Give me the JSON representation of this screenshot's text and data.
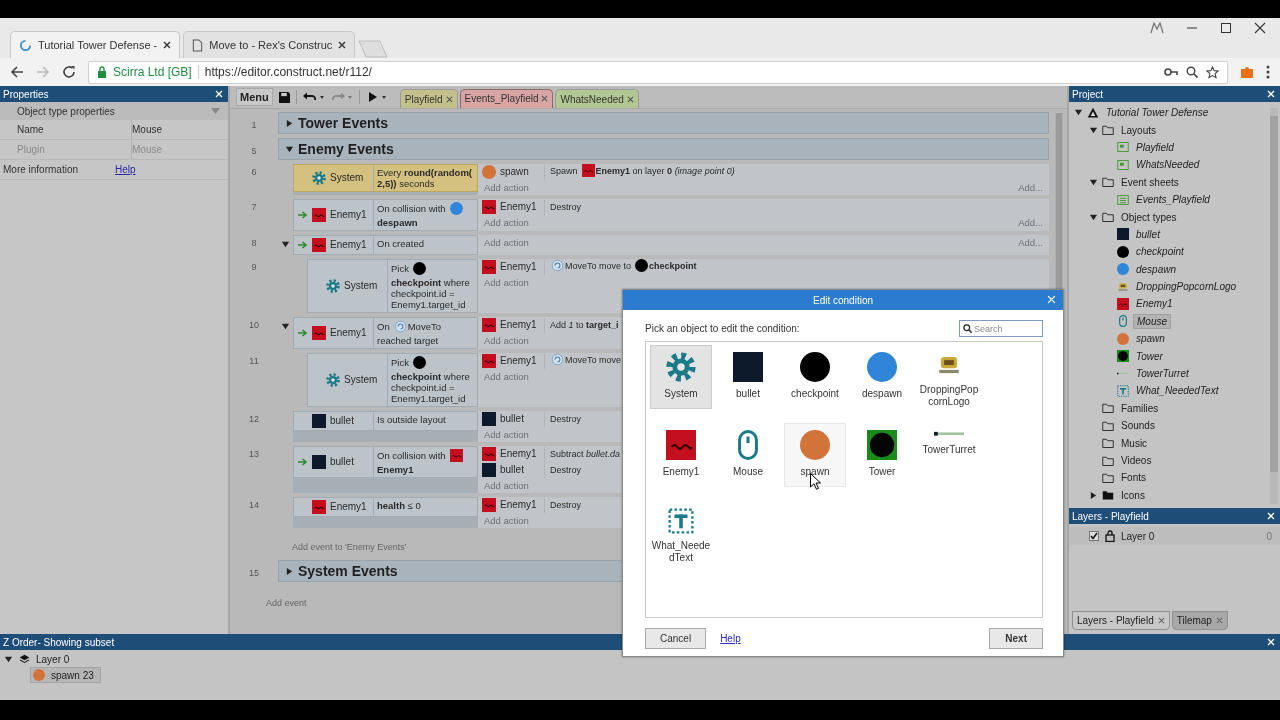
{
  "browser": {
    "tabs": [
      {
        "title": "Tutorial Tower Defense -",
        "selected": true
      },
      {
        "title": "Move to - Rex's Construc",
        "selected": false
      }
    ],
    "security_label": "Scirra Ltd [GB]",
    "url": "https://editor.construct.net/r112/"
  },
  "properties": {
    "title": "Properties",
    "section": "Object type properties",
    "rows": [
      {
        "name": "Name",
        "value": "Mouse",
        "disabled": false
      },
      {
        "name": "Plugin",
        "value": "Mouse",
        "disabled": true
      }
    ],
    "info_label": "More information",
    "info_link": "Help"
  },
  "toolbar": {
    "menu": "Menu",
    "redo_disabled": true,
    "tabs": [
      {
        "label": "Playfield",
        "color": "#c4c08c",
        "selected": false
      },
      {
        "label": "Events_Playfield",
        "color": "#d8a4a4",
        "selected": true
      },
      {
        "label": "WhatsNeeded",
        "color": "#b3c792",
        "selected": false
      }
    ]
  },
  "event_sheet": {
    "groups": [
      {
        "line": "1",
        "title": "Tower Events",
        "expanded": false
      },
      {
        "line": "5",
        "title": "Enemy Events",
        "expanded": true,
        "add_event": "Add event to 'Enemy Events'",
        "events": [
          {
            "line": "6",
            "trigger": false,
            "selected": true,
            "conditions": [
              {
                "kind": "system",
                "object": "System",
                "parts": [
                  {
                    "kind": "text",
                    "text": "Every **round(random(**"
                  },
                  {
                    "kind": "text",
                    "text": "**2,5))** seconds"
                  }
                ]
              }
            ],
            "actions": [
              {
                "kind": "spawn",
                "object": "spawn",
                "parts": [
                  {
                    "kind": "text",
                    "text": "Spawn"
                  },
                  {
                    "kind": "enemy"
                  },
                  {
                    "kind": "text",
                    "text": "**Enemy1** on layer **0** *(image point 0)*"
                  }
                ]
              }
            ],
            "add_action": "Add action",
            "add_more": "Add..."
          },
          {
            "line": "7",
            "trigger": true,
            "selected": false,
            "conditions": [
              {
                "kind": "enemy",
                "object": "Enemy1",
                "parts": [
                  {
                    "kind": "text",
                    "text": "On collision with"
                  },
                  {
                    "kind": "despawn"
                  },
                  {
                    "kind": "text",
                    "text": "**despawn**"
                  }
                ]
              }
            ],
            "actions": [
              {
                "kind": "enemy",
                "object": "Enemy1",
                "parts": [
                  {
                    "kind": "text",
                    "text": "Destroy"
                  }
                ]
              }
            ],
            "add_action": "Add action",
            "add_more": "Add..."
          },
          {
            "line": "8",
            "trigger": true,
            "selected": false,
            "expanded": true,
            "conditions": [
              {
                "kind": "enemy",
                "object": "Enemy1",
                "parts": [
                  {
                    "kind": "text",
                    "text": "On created"
                  }
                ]
              }
            ],
            "add_action": "Add action",
            "add_more": "Add...",
            "children": [
              {
                "line": "9",
                "trigger": false,
                "selected": false,
                "conditions": [
                  {
                    "kind": "system",
                    "object": "System",
                    "parts": [
                      {
                        "kind": "text",
                        "text": "Pick"
                      },
                      {
                        "kind": "checkpoint"
                      },
                      {
                        "kind": "text",
                        "text": "**checkpoint** where"
                      },
                      {
                        "kind": "text",
                        "text": "checkpoint.id ="
                      },
                      {
                        "kind": "text",
                        "text": "Enemy1.target_id"
                      }
                    ]
                  }
                ],
                "actions": [
                  {
                    "kind": "enemy",
                    "object": "Enemy1",
                    "parts": [
                      {
                        "kind": "moveto"
                      },
                      {
                        "kind": "text",
                        "text": "MoveTo move to"
                      },
                      {
                        "kind": "checkpoint"
                      },
                      {
                        "kind": "text",
                        "text": "**checkpoint**"
                      }
                    ]
                  }
                ],
                "add_action": "Add action"
              }
            ]
          },
          {
            "line": "10",
            "trigger": true,
            "selected": false,
            "expanded": true,
            "conditions": [
              {
                "kind": "enemy",
                "object": "Enemy1",
                "parts": [
                  {
                    "kind": "text",
                    "text": "On"
                  },
                  {
                    "kind": "moveto"
                  },
                  {
                    "kind": "text",
                    "text": "MoveTo"
                  },
                  {
                    "kind": "text",
                    "text": "reached target"
                  }
                ]
              }
            ],
            "actions": [
              {
                "kind": "enemy",
                "object": "Enemy1",
                "parts": [
                  {
                    "kind": "text",
                    "text": "Add *1* to **target_i**"
                  }
                ]
              }
            ],
            "add_action": "Add action",
            "children": [
              {
                "line": "11",
                "trigger": false,
                "selected": false,
                "conditions": [
                  {
                    "kind": "system",
                    "object": "System",
                    "parts": [
                      {
                        "kind": "text",
                        "text": "Pick"
                      },
                      {
                        "kind": "checkpoint"
                      },
                      {
                        "kind": "text",
                        "text": "**checkpoint** where"
                      },
                      {
                        "kind": "text",
                        "text": "checkpoint.id ="
                      },
                      {
                        "kind": "text",
                        "text": "Enemy1.target_id"
                      }
                    ]
                  }
                ],
                "actions": [
                  {
                    "kind": "enemy",
                    "object": "Enemy1",
                    "parts": [
                      {
                        "kind": "moveto"
                      },
                      {
                        "kind": "text",
                        "text": "MoveTo move"
                      }
                    ]
                  }
                ],
                "add_action": "Add action"
              }
            ]
          },
          {
            "line": "12",
            "trigger": false,
            "selected": false,
            "conditions": [
              {
                "kind": "bullet",
                "object": "bullet",
                "parts": [
                  {
                    "kind": "text",
                    "text": "Is outside layout"
                  }
                ]
              }
            ],
            "actions": [
              {
                "kind": "bullet",
                "object": "bullet",
                "parts": [
                  {
                    "kind": "text",
                    "text": "Destroy"
                  }
                ]
              }
            ],
            "add_action": "Add action"
          },
          {
            "line": "13",
            "trigger": true,
            "selected": false,
            "conditions": [
              {
                "kind": "bullet",
                "object": "bullet",
                "parts": [
                  {
                    "kind": "text",
                    "text": "On collision with"
                  },
                  {
                    "kind": "enemy"
                  },
                  {
                    "kind": "text",
                    "text": "**Enemy1**"
                  }
                ]
              }
            ],
            "actions": [
              {
                "kind": "enemy",
                "object": "Enemy1",
                "parts": [
                  {
                    "kind": "text",
                    "text": "Subtract *bullet.da*"
                  }
                ]
              },
              {
                "kind": "bullet",
                "object": "bullet",
                "parts": [
                  {
                    "kind": "text",
                    "text": "Destroy"
                  }
                ]
              }
            ],
            "add_action": "Add action"
          },
          {
            "line": "14",
            "trigger": false,
            "selected": false,
            "conditions": [
              {
                "kind": "enemy",
                "object": "Enemy1",
                "parts": [
                  {
                    "kind": "text",
                    "text": "**health** ≤ 0"
                  }
                ]
              }
            ],
            "actions": [
              {
                "kind": "enemy",
                "object": "Enemy1",
                "parts": [
                  {
                    "kind": "text",
                    "text": "Destroy"
                  }
                ]
              }
            ],
            "add_action": "Add action"
          }
        ]
      },
      {
        "line": "15",
        "title": "System Events",
        "expanded": false
      }
    ],
    "add_event": "Add event"
  },
  "project": {
    "title": "Project",
    "tree": [
      {
        "label": "Tutorial Tower Defense",
        "kind": "root",
        "expanded": true,
        "selected": false,
        "children": [
          {
            "label": "Layouts",
            "kind": "folder",
            "expanded": true,
            "selected": false,
            "children": [
              {
                "label": "Playfield",
                "kind": "layout",
                "selected": false
              },
              {
                "label": "WhatsNeeded",
                "kind": "layout",
                "selected": false
              }
            ]
          },
          {
            "label": "Event sheets",
            "kind": "folder",
            "expanded": true,
            "selected": false,
            "children": [
              {
                "label": "Events_Playfield",
                "kind": "sheet",
                "selected": false
              }
            ]
          },
          {
            "label": "Object types",
            "kind": "folder",
            "expanded": true,
            "selected": false,
            "children": [
              {
                "label": "bullet",
                "kind": "bullet",
                "selected": false
              },
              {
                "label": "checkpoint",
                "kind": "checkpoint",
                "selected": false
              },
              {
                "label": "despawn",
                "kind": "despawn",
                "selected": false
              },
              {
                "label": "DroppingPopcornLogo",
                "kind": "popcorn",
                "selected": false
              },
              {
                "label": "Enemy1",
                "kind": "enemy",
                "selected": false
              },
              {
                "label": "Mouse",
                "kind": "mouse",
                "selected": true
              },
              {
                "label": "spawn",
                "kind": "spawn",
                "selected": false
              },
              {
                "label": "Tower",
                "kind": "tower",
                "selected": false
              },
              {
                "label": "TowerTurret",
                "kind": "turret",
                "selected": false
              },
              {
                "label": "What_NeededText",
                "kind": "text",
                "selected": false
              }
            ]
          },
          {
            "label": "Families",
            "kind": "folder",
            "selected": false
          },
          {
            "label": "Sounds",
            "kind": "folder",
            "selected": false
          },
          {
            "label": "Music",
            "kind": "folder",
            "selected": false
          },
          {
            "label": "Videos",
            "kind": "folder",
            "selected": false
          },
          {
            "label": "Fonts",
            "kind": "folder",
            "selected": false
          },
          {
            "label": "Icons",
            "kind": "folder-full",
            "expanded": false,
            "selected": false
          }
        ]
      }
    ]
  },
  "layers": {
    "title": "Layers - Playfield",
    "rows": [
      {
        "name": "Layer 0",
        "visible": true,
        "count": "0"
      }
    ],
    "tabs": [
      {
        "label": "Layers - Playfield",
        "selected": true
      },
      {
        "label": "Tilemap",
        "selected": false
      }
    ]
  },
  "z_order": {
    "title": "Z Order- Showing subset",
    "layers": [
      {
        "name": "Layer 0",
        "expanded": true,
        "children": [
          {
            "name": "spawn 23",
            "kind": "spawn",
            "selected": true
          }
        ]
      }
    ]
  },
  "dialog": {
    "title": "Edit condition",
    "prompt": "Pick an object to edit the condition:",
    "search_placeholder": "Search",
    "objects": [
      {
        "name": "System",
        "kind": "system",
        "selected": true,
        "hovered": false
      },
      {
        "name": "bullet",
        "kind": "bullet",
        "selected": false,
        "hovered": false
      },
      {
        "name": "checkpoint",
        "kind": "checkpoint",
        "selected": false,
        "hovered": false
      },
      {
        "name": "despawn",
        "kind": "despawn",
        "selected": false,
        "hovered": false
      },
      {
        "name": "DroppingPopcornLogo",
        "kind": "popcorn",
        "selected": false,
        "hovered": false
      },
      {
        "name": "Enemy1",
        "kind": "enemy",
        "selected": false,
        "hovered": false
      },
      {
        "name": "Mouse",
        "kind": "mouse",
        "selected": false,
        "hovered": false
      },
      {
        "name": "spawn",
        "kind": "spawn",
        "selected": false,
        "hovered": true
      },
      {
        "name": "Tower",
        "kind": "tower",
        "selected": false,
        "hovered": false
      },
      {
        "name": "TowerTurret",
        "kind": "turret",
        "selected": false,
        "hovered": false
      },
      {
        "name": "What_NeededText",
        "kind": "text",
        "selected": false,
        "hovered": false
      }
    ],
    "cancel": "Cancel",
    "help": "Help",
    "next": "Next"
  }
}
